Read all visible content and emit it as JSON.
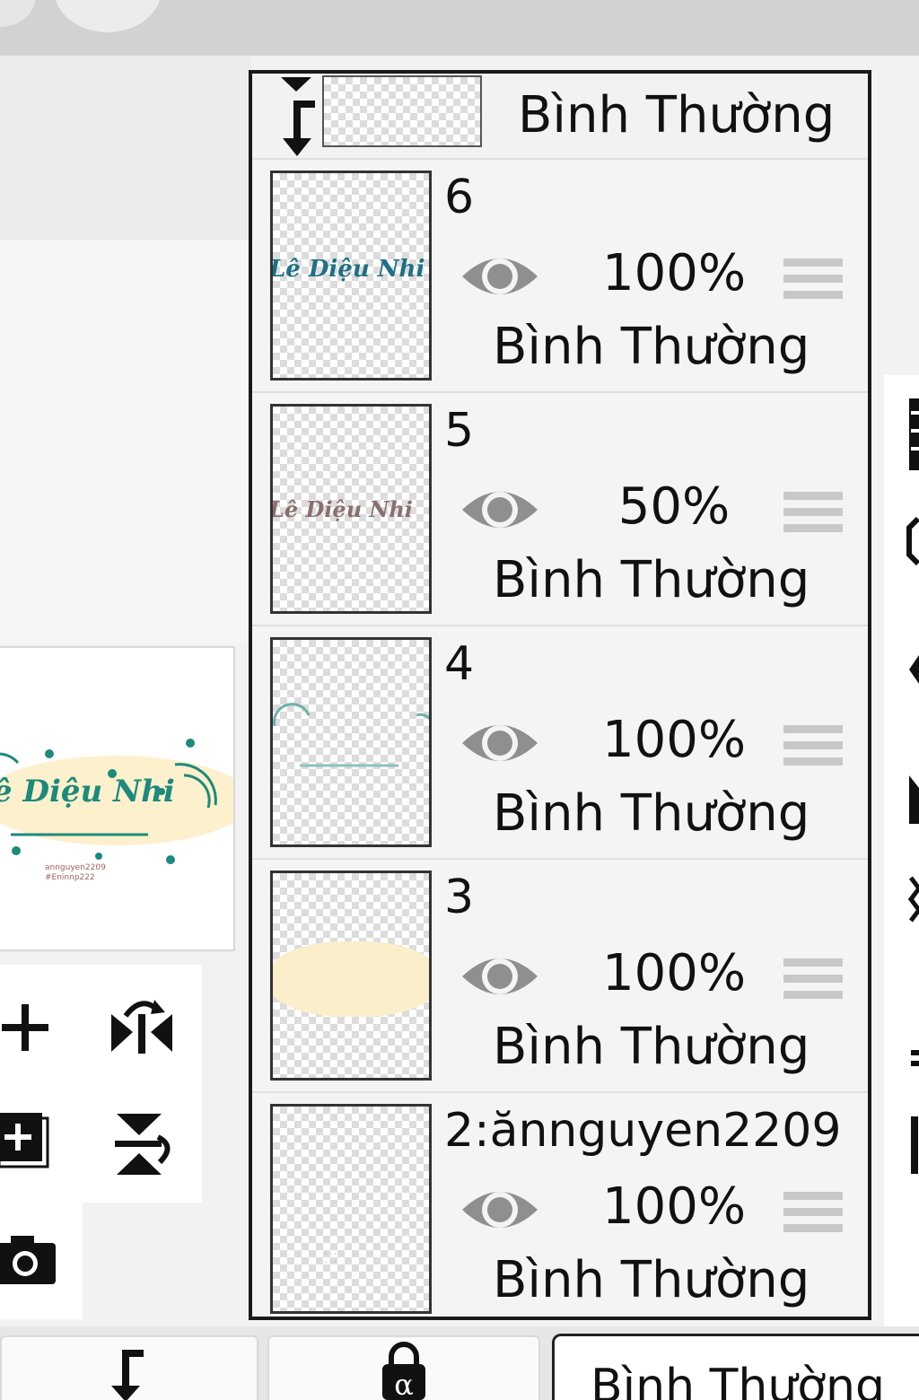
{
  "header": {
    "icons": [
      "circle-button-icon"
    ]
  },
  "clipping_row": {
    "blend_mode": "Bình Thường",
    "icon": "clip-arrow-icon"
  },
  "layers": [
    {
      "name": "6",
      "opacity": "100%",
      "blend_mode": "Bình Thường",
      "thumb_text": "Lê Diệu Nhi"
    },
    {
      "name": "5",
      "opacity": "50%",
      "blend_mode": "Bình Thường",
      "thumb_text": "Lê Diệu Nhi"
    },
    {
      "name": "4",
      "opacity": "100%",
      "blend_mode": "Bình Thường"
    },
    {
      "name": "3",
      "opacity": "100%",
      "blend_mode": "Bình Thường"
    },
    {
      "name": "2:ănnguyen2209",
      "opacity": "100%",
      "blend_mode": "Bình Thường"
    }
  ],
  "canvas_preview": {
    "title": "ê Diệu Nhi",
    "subtext": [
      "annguyen2209",
      "#Eninnp222"
    ]
  },
  "tools": [
    "add-layer-icon",
    "flip-horizontal-icon",
    "add-special-layer-icon",
    "flip-vertical-icon",
    "camera-icon"
  ],
  "bottom_bar": {
    "back_icon": "clip-arrow-icon",
    "lock_icon": "alpha-lock-icon",
    "blend_mode": "Bình Thường"
  },
  "colors": {
    "panel_border": "#1a1a1a",
    "eye": "#8f8f8f",
    "handle": "#c8c8c8",
    "accent_teal": "#1c8a7d",
    "highlight": "#fdf0cc"
  }
}
